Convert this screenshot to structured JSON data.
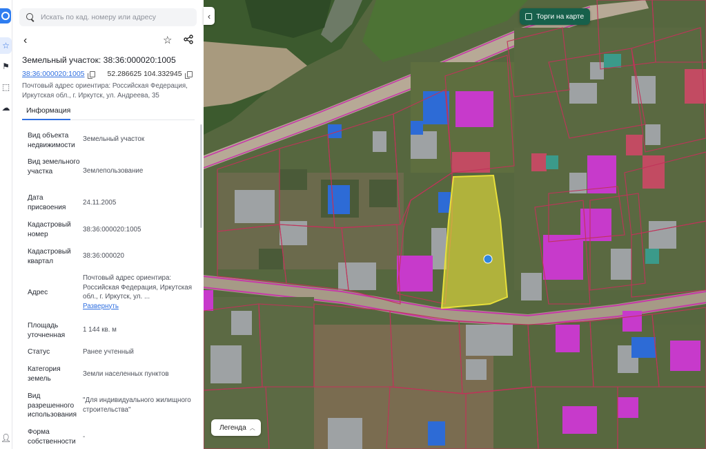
{
  "search": {
    "placeholder": "Искать по кад. номеру или адресу"
  },
  "object": {
    "title": "Земельный участок: 38:36:000020:1005",
    "cad_number": "38:36:000020:1005",
    "coordinates": "52.286625 104.332945",
    "postal_address": "Почтовый адрес ориентира: Российская Федерация, Иркутская обл., г. Иркутск, ул. Андреева, 35"
  },
  "tabs": [
    {
      "label": "Информация",
      "active": true
    }
  ],
  "info": {
    "rows": [
      {
        "key": "Вид объекта недвижимости",
        "value": "Земельный участок"
      },
      {
        "key": "Вид земельного участка",
        "value": "Землепользование"
      },
      {
        "key": "Дата присвоения",
        "value": "24.11.2005"
      },
      {
        "key": "Кадастровый номер",
        "value": "38:36:000020:1005"
      },
      {
        "key": "Кадастровый квартал",
        "value": "38:36:000020"
      },
      {
        "key": "Адрес",
        "value": "Почтовый адрес ориентира: Российская Федерация, Иркутская обл., г. Иркутск, ул. ...",
        "link": "Развернуть"
      },
      {
        "key": "Площадь уточненная",
        "value": "1 144 кв. м"
      },
      {
        "key": "Статус",
        "value": "Ранее учтенный"
      },
      {
        "key": "Категория земель",
        "value": "Земли населенных пунктов"
      },
      {
        "key": "Вид разрешенного использования",
        "value": "\"Для индивидуального жилищного строительства\""
      },
      {
        "key": "Форма собственности",
        "value": "-"
      }
    ]
  },
  "map": {
    "auction_toggle": "Торги на карте",
    "legend_button": "Легенда"
  },
  "colors": {
    "accent": "#2f6fe0",
    "parcel_highlight": "#e8e03a",
    "boundary": "#c0335a",
    "road_boundary": "#c63aa7",
    "auction_bg": "#17604b"
  },
  "icons": {
    "rail": [
      "logo-icon",
      "star-icon",
      "flag-icon",
      "select-area-icon",
      "cloud-icon",
      "user-icon"
    ],
    "toolbar": [
      "chevron-left-icon",
      "star-icon",
      "share-icon",
      "copy-icon"
    ]
  }
}
